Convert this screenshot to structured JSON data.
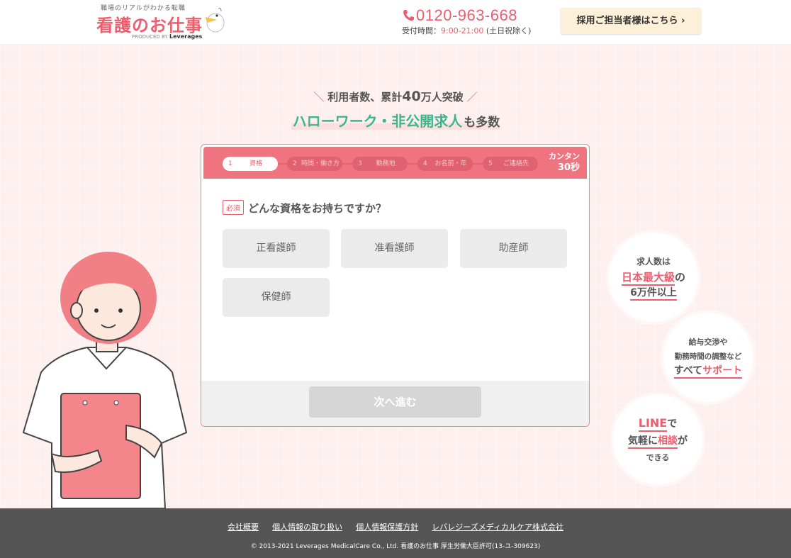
{
  "header": {
    "logo_tagline": "職場のリアルがわかる転職",
    "logo_main": "看護のお仕事",
    "logo_produced": "PRODUCED BY",
    "logo_brand": "Leverages",
    "phone_number": "0120-963-668",
    "hours_label": "受付時間：",
    "hours_time": "9:00-21:00",
    "hours_note": "(土日祝除く)",
    "hire_button": "採用ご担当者様はこちら ›"
  },
  "catch": {
    "line1_a": "利用者数、累計",
    "line1_big": "40",
    "line1_b": "万人突破",
    "line2_green": "ハローワーク・非公開求人",
    "line2_rest": "も多数"
  },
  "steps": [
    {
      "num": "1",
      "label": "資格"
    },
    {
      "num": "2",
      "label": "時間・働き方"
    },
    {
      "num": "3",
      "label": "勤務地"
    },
    {
      "num": "4",
      "label": "お名前・年"
    },
    {
      "num": "5",
      "label": "ご連絡先"
    }
  ],
  "kantan": {
    "line1": "カンタン",
    "line2": "30秒"
  },
  "question": {
    "required": "必須",
    "text": "どんな資格をお持ちですか？"
  },
  "options": [
    "正看護師",
    "准看護師",
    "助産師",
    "保健師"
  ],
  "next_button": "次へ進む",
  "bubbles": {
    "b1": {
      "l1": "求人数は",
      "l2": "日本最大級",
      "l2b": "の",
      "l3": "6万件以上"
    },
    "b2": {
      "l1": "給与交渉や",
      "l2": "勤務時間の調整など",
      "l3a": "すべて",
      "l3b": "サポート"
    },
    "b3": {
      "l1a": "LINE",
      "l1b": "で",
      "l2a": "気軽に",
      "l2b": "相談",
      "l2c": "が",
      "l3": "できる"
    }
  },
  "footer": {
    "links": [
      "会社概要",
      "個人情報の取り扱い",
      "個人情報保護方針",
      "レバレジーズメディカルケア株式会社"
    ],
    "copyright": "© 2013-2021 Leverages MedicalCare Co., Ltd. 看護のお仕事 厚生労働大臣許可(13-ユ-309623)"
  },
  "colors": {
    "brand": "#ea5f6e",
    "accent_green": "#3cb58d",
    "footer_bg": "#555555"
  }
}
